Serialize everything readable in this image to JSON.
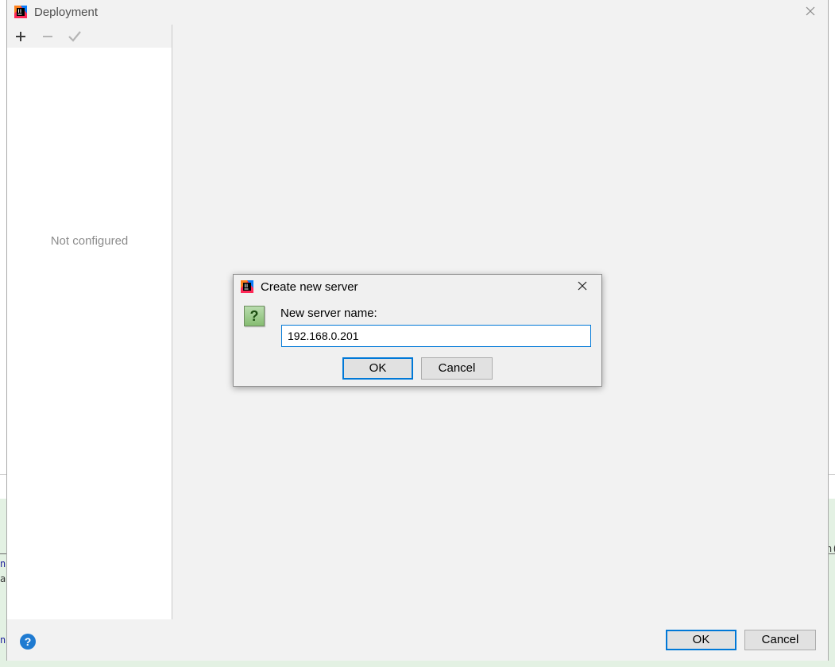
{
  "window": {
    "title": "Deployment",
    "app_icon": "intellij-idea-icon",
    "close_icon": "close-icon"
  },
  "toolbar": {
    "items": [
      {
        "name": "add-icon",
        "label": "+"
      },
      {
        "name": "remove-icon",
        "label": "−"
      },
      {
        "name": "check-icon",
        "label": "✓"
      }
    ]
  },
  "left_panel": {
    "empty_text": "Not configured"
  },
  "footer": {
    "help_icon": "?",
    "ok_label": "OK",
    "cancel_label": "Cancel"
  },
  "modal": {
    "title": "Create new server",
    "question_icon": "?",
    "field_label": "New server name:",
    "field_value": "192.168.0.201",
    "ok_label": "OK",
    "cancel_label": "Cancel"
  },
  "background": {
    "code_fragments": [
      "n",
      "a",
      "n",
      "n(",
      "n"
    ]
  },
  "colors": {
    "accent": "#0078d7",
    "dialog_bg": "#f2f2f2",
    "muted_text": "#8c8c8c",
    "help_blue": "#1f7bd1",
    "question_green": "#86bd72"
  }
}
